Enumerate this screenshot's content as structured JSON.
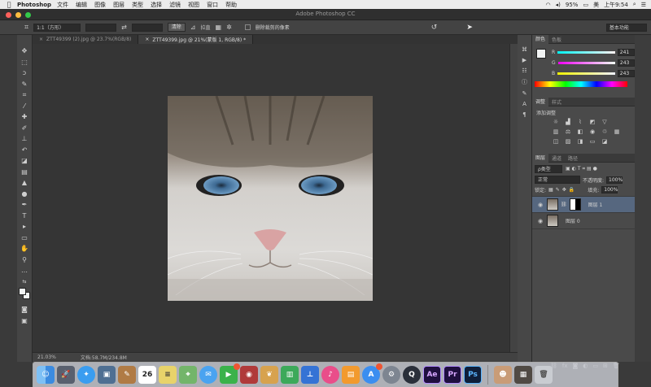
{
  "menubar": {
    "app_name": "Photoshop",
    "items": [
      "文件",
      "编辑",
      "图像",
      "图层",
      "类型",
      "选择",
      "滤镜",
      "视图",
      "窗口",
      "帮助"
    ],
    "battery": "95%",
    "input_source": "美",
    "clock": "上午9:54"
  },
  "window": {
    "title": "Adobe Photoshop CC"
  },
  "options_bar": {
    "ratio": "1:1（方形）",
    "clear_label": "清除",
    "straighten_label": "拉直",
    "delete_cropped_label": "删除裁剪的像素",
    "workspace": "基本功能"
  },
  "doc_tabs": [
    {
      "label": "ZTT49399 (2).jpg @ 23.7%(RGB/8)"
    },
    {
      "label": "ZTT49399.jpg @ 21%(蒙版 1, RGB/8) *"
    }
  ],
  "status": {
    "zoom": "21.03%",
    "doc_size": "文档:58.7M/234.8M"
  },
  "color_panel": {
    "tabs": [
      "颜色",
      "色板"
    ],
    "r_label": "R",
    "g_label": "G",
    "b_label": "B",
    "r": "241",
    "g": "243",
    "b": "243"
  },
  "adjust_panel": {
    "tabs": [
      "调整",
      "样式"
    ],
    "heading": "添加调整"
  },
  "layers_panel": {
    "tabs": [
      "图层",
      "通道",
      "路径"
    ],
    "filter_kind": "ρ类型",
    "blend_mode": "正常",
    "opacity_label": "不透明度:",
    "opacity": "100%",
    "lock_label": "锁定:",
    "fill_label": "填充:",
    "fill": "100%",
    "layers": [
      {
        "name": "图层 1"
      },
      {
        "name": "图层 0"
      }
    ]
  },
  "dock": {
    "calendar_day": "26",
    "ae_label": "Ae",
    "pr_label": "Pr",
    "ps_label": "Ps"
  },
  "colors": {
    "accent": "#5b8cc4",
    "selected_layer": "#56677f",
    "panel": "#4a4a4a"
  }
}
